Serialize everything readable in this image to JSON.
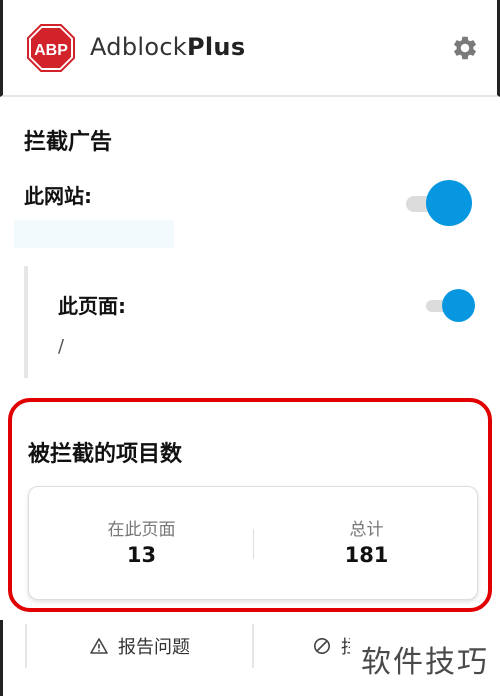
{
  "header": {
    "logo_text": "ABP",
    "brand_prefix": "Adblock",
    "brand_bold": "Plus",
    "settings_icon": "gear-icon"
  },
  "block_ads": {
    "section_title": "拦截广告",
    "site_label": "此网站:",
    "site_enabled": true,
    "page_label": "此页面:",
    "page_path": "/",
    "page_enabled": true
  },
  "blocked_stats": {
    "title": "被拦截的项目数",
    "on_this_page_label": "在此页面",
    "on_this_page_value": "13",
    "total_label": "总计",
    "total_value": "181"
  },
  "footer": {
    "report_label": "报告问题",
    "report_icon": "warning-icon",
    "block_icon": "block-icon",
    "block_label_visible": "拦"
  },
  "watermark": {
    "text": "软件技巧"
  },
  "colors": {
    "accent": "#0797e1",
    "highlight_border": "#e00000",
    "logo_red": "#d2232a"
  }
}
